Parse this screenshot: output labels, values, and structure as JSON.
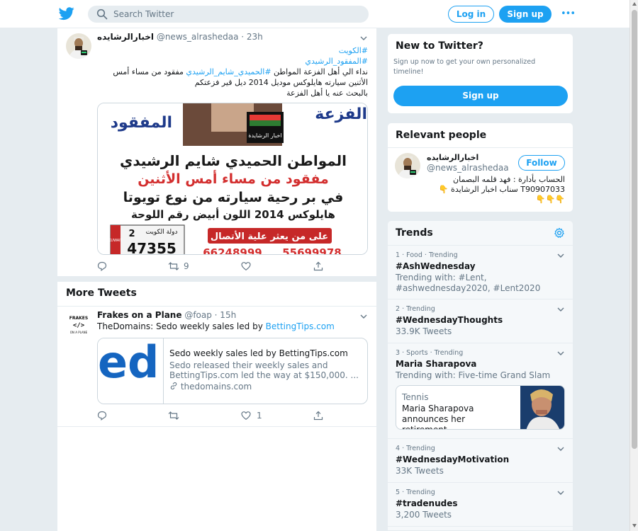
{
  "header": {
    "search_placeholder": "Search Twitter",
    "login_label": "Log in",
    "signup_label": "Sign up",
    "more_label": "•••"
  },
  "tweet": {
    "author_name": "اخبارالرشايده",
    "handle_time": "@news_alrashedaa · 23h",
    "hashtag1": "#الكويت",
    "hashtag2": "#المفقود_الرشيدي",
    "body_line1_a": "نداء الي أهل الفزعة المواطن ",
    "body_line1_tag": "#الحميدي_شايم_الرشيدي",
    "body_line1_b": " مفقود من مساء أمس",
    "body_line2": "الأثنين سيارته هايلوكس موديل 2014 ديل قير فزعتكم",
    "body_line3": "بالبحث عنه يا أهل الفزعة",
    "image": {
      "top_left_word": "المفقود",
      "top_right_word": "الفزعة",
      "logo_text": "اخبار الرشايدة",
      "line1": "المواطن الحميدي شايم الرشيدي",
      "line2": "مفقود من مساء أمس الأثنين",
      "line3": "في بر رحية سيارته من نوع تويوتا",
      "line4": "هايلوكس 2014 اللون أبيض رقم اللوحة",
      "plate_country": "دولة الكويت",
      "plate_kuwait": "KUWAIT",
      "plate_code": "2",
      "plate_number": "47355",
      "banner_text": "على من يعثر علية الأتصال",
      "phone1": "66248999",
      "phone2": "55699978"
    },
    "retweet_count": "9"
  },
  "more_tweets_title": "More Tweets",
  "tweet2": {
    "author_name": "Frakes on a Plane",
    "handle_time": "@foap · 15h",
    "body_text": "TheDomains: Sedo weekly sales led by ",
    "body_link": "BettingTips.com",
    "avatar_text_top": "FRAKES",
    "avatar_text_bottom": "ON A PLANE",
    "card": {
      "thumb_text": "ed",
      "title": "Sedo weekly sales led by BettingTips.com",
      "desc_line1": "Sedo released their weekly sales and",
      "desc_line2": "BettingTips.com led the way at $150,000. ...",
      "domain": "thedomains.com"
    },
    "like_count": "1"
  },
  "new_to_twitter": {
    "title": "New to Twitter?",
    "sub_line1": "Sign up now to get your own personalized",
    "sub_line2": "timeline!",
    "button": "Sign up"
  },
  "relevant_people": {
    "title": "Relevant people",
    "name": "اخبارالرشايده",
    "handle": "@news_alrashedaa",
    "follow": "Follow",
    "bio_line1": "الحساب بأدارة : فهد قلمه البصمان",
    "bio_line2": "T90907033 سناب اخبار الرشايدة 👇",
    "bio_line3": "👇👇👇"
  },
  "trends": {
    "title": "Trends",
    "items": [
      {
        "meta": "1 · Food · Trending",
        "name": "#AshWednesday",
        "sub1": "Trending with: #Lent,",
        "sub2": "#ashwednesday2020, #Lent2020"
      },
      {
        "meta": "2 · Trending",
        "name": "#WednesdayThoughts",
        "sub1": "33.9K Tweets"
      },
      {
        "meta": "3 · Sports · Trending",
        "name": "Maria Sharapova",
        "sub1": "Trending with: Five-time Grand Slam"
      },
      {
        "meta": "4 · Trending",
        "name": "#WednesdayMotivation",
        "sub1": "33K Tweets"
      },
      {
        "meta": "5 · Trending",
        "name": "#tradenudes",
        "sub1": "3,200 Tweets"
      }
    ],
    "news": {
      "category": "Tennis",
      "line1": "Maria Sharapova",
      "line2": "announces her retirement..."
    }
  }
}
